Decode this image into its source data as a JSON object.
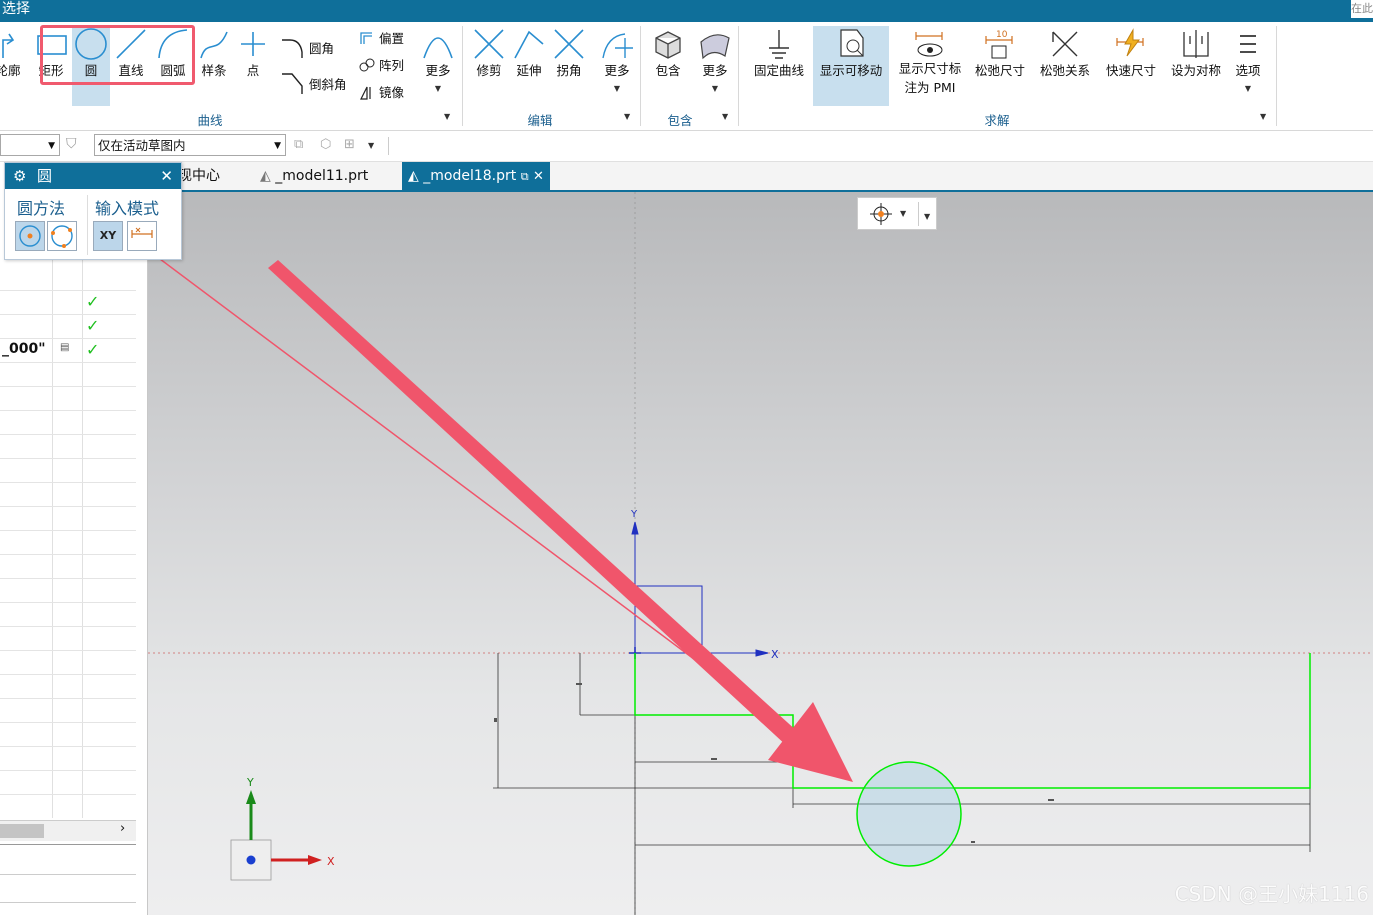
{
  "title_bar": {
    "title": "选择",
    "right_fragment": "在此"
  },
  "ribbon": {
    "curve_group": {
      "label": "曲线",
      "buttons": [
        {
          "label": "轮廓",
          "icon": "profile-icon"
        },
        {
          "label": "矩形",
          "icon": "rectangle-icon"
        },
        {
          "label": "圆",
          "icon": "circle-icon",
          "selected": true
        },
        {
          "label": "直线",
          "icon": "line-icon"
        },
        {
          "label": "圆弧",
          "icon": "arc-icon"
        },
        {
          "label": "样条",
          "icon": "spline-icon"
        },
        {
          "label": "点",
          "icon": "point-icon"
        }
      ],
      "small_buttons": [
        "圆角",
        "倒斜角",
        "偏置",
        "阵列",
        "镜像"
      ],
      "more": "更多"
    },
    "edit_group": {
      "label": "编辑",
      "buttons": [
        "修剪",
        "延伸",
        "拐角",
        "更多"
      ]
    },
    "include_group": {
      "label": "包含",
      "buttons": [
        "包含",
        "更多"
      ]
    },
    "solve_group": {
      "label": "求解",
      "buttons": [
        "固定曲线",
        "显示可移动",
        "显示尺寸标注为 PMI",
        "松弛尺寸",
        "松弛关系",
        "快速尺寸",
        "设为对称",
        "选项"
      ],
      "pmi_line1": "显示尺寸标",
      "pmi_line2": "注为 PMI",
      "relax_dim_badge": "10"
    }
  },
  "filter_bar": {
    "scope": "仅在活动草图内"
  },
  "tabs": [
    "发现中心",
    "_model11.prt",
    "_model18.prt"
  ],
  "circle_dialog": {
    "title": "圆",
    "method_label": "圆方法",
    "input_mode_label": "输入模式",
    "xy_label": "XY"
  },
  "left_panel": {
    "value_text": "_000\""
  },
  "canvas": {
    "axis_labels": {
      "y": "Y",
      "x": "X"
    },
    "triad": {
      "y": "Y",
      "x": "X"
    }
  },
  "watermark": "CSDN @王小妹1116",
  "colors": {
    "accent": "#0f6f9a",
    "highlight": "#f05a6e",
    "arrow": "#f0556b",
    "sketch_green": "#00ee00"
  }
}
